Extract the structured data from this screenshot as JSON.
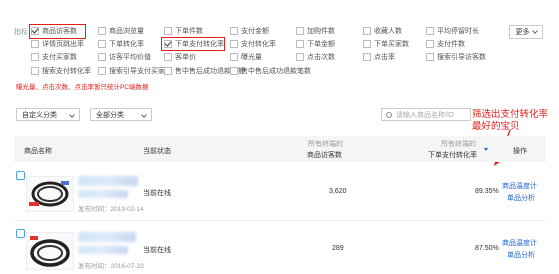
{
  "filters": {
    "label": "指标",
    "more": "更多",
    "rows": [
      [
        "商品访客数",
        "商品浏览量",
        "下单件数",
        "支付金额",
        "加购件数",
        "收藏人数",
        "平均停留时长"
      ],
      [
        "详情页跳出率",
        "下单转化率",
        "下单支付转化率",
        "支付转化率",
        "下单金额",
        "下单买家数",
        "支付件数"
      ],
      [
        "支付买家数",
        "访客平均价值",
        "客单价",
        "曝光量",
        "点击次数",
        "点击率",
        "搜索引导访客数"
      ],
      [
        "搜索支付转化率",
        "搜索引导支付买家数",
        "售中售后成功退款金额",
        "售中售后成功退款笔数"
      ]
    ],
    "note": "曝光量、点击次数、点击率暂只统计PC端数据"
  },
  "controls": {
    "category_select": "自定义分类",
    "brand_select": "全部分类",
    "search_placeholder": "请输入商品名称/ID"
  },
  "annotation": "筛选出支付转化率最好的宝贝",
  "table": {
    "headers": {
      "product": "商品名称",
      "status": "当前状态",
      "metric1_sub": "所有终端的",
      "metric1": "商品访客数",
      "metric2_sub": "所有终端的",
      "metric2": "下单支付转化率",
      "ops": "操作"
    },
    "rows": [
      {
        "publish": "发布时间：2019-02-14",
        "status": "当前在线",
        "visitors": "3,620",
        "rate": "89.35%",
        "op1": "商品温度计",
        "op2": "单品分析"
      },
      {
        "publish": "发布时间：2016-07-23",
        "status": "当前在线",
        "visitors": "289",
        "rate": "87.50%",
        "op1": "商品温度计",
        "op2": "单品分析"
      }
    ]
  },
  "colors": {
    "highlight": "#e0201b",
    "link": "#1d63c9"
  }
}
